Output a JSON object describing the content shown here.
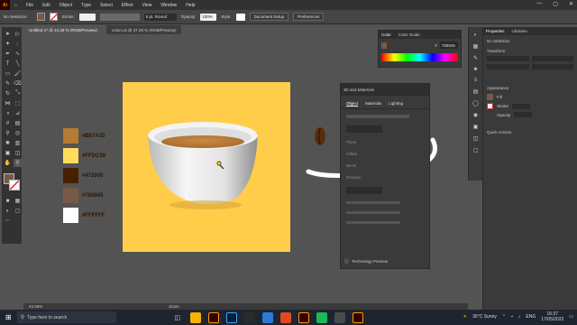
{
  "app": {
    "logo": "Ai"
  },
  "menu": [
    "File",
    "Edit",
    "Object",
    "Type",
    "Select",
    "Effect",
    "View",
    "Window",
    "Help"
  ],
  "control_bar": {
    "selection": "No Selection",
    "stroke_label": "Stroke:",
    "brush": "5 pt. Round",
    "opacity_label": "Opacity:",
    "opacity_value": "100%",
    "style_label": "Style:",
    "document_setup": "Document Setup",
    "preferences": "Preferences"
  },
  "tabs": [
    {
      "label": "Untitled-1* @ 44.28 % (RGB/Preview)",
      "active": true
    },
    {
      "label": "colors.ai @ 37.28 % (RGB/Preview)",
      "active": false
    }
  ],
  "swatches": [
    {
      "hex": "#B57A33",
      "color": "#b57a33"
    },
    {
      "hex": "#FFDC59",
      "color": "#ffdc59"
    },
    {
      "hex": "#472000",
      "color": "#472000"
    },
    {
      "hex": "#785945",
      "color": "#785945"
    },
    {
      "hex": "#FFFFFF",
      "color": "#ffffff"
    }
  ],
  "color_panel": {
    "tabs": [
      "Color",
      "Color Guide"
    ],
    "hex_value": "785945"
  },
  "threed_panel": {
    "title": "3D and Materials",
    "tabs": [
      "Object",
      "Materials",
      "Lighting"
    ],
    "rows": [
      "Plane",
      "Inflate",
      "Bevel",
      "Rotation"
    ],
    "footer": "Technology Preview"
  },
  "properties_panel": {
    "tabs": [
      "Properties",
      "Libraries"
    ],
    "selection": "No Selection",
    "transform_label": "Transform",
    "appearance_label": "Appearance",
    "fill_label": "Fill",
    "stroke_label": "Stroke",
    "opacity_label": "Opacity",
    "quick_actions_label": "Quick Actions"
  },
  "status_bar": {
    "zoom": "44.28%",
    "tool": "Zoom"
  },
  "taskbar": {
    "search_placeholder": "Type here to search",
    "weather": "36°C  Sunny",
    "language": "ENG",
    "time": "16:37",
    "date": "17/05/2022"
  },
  "colors": {
    "artboard": "#ffcd4a",
    "coffee": "#b57a33",
    "accent": "#ff9a00"
  }
}
